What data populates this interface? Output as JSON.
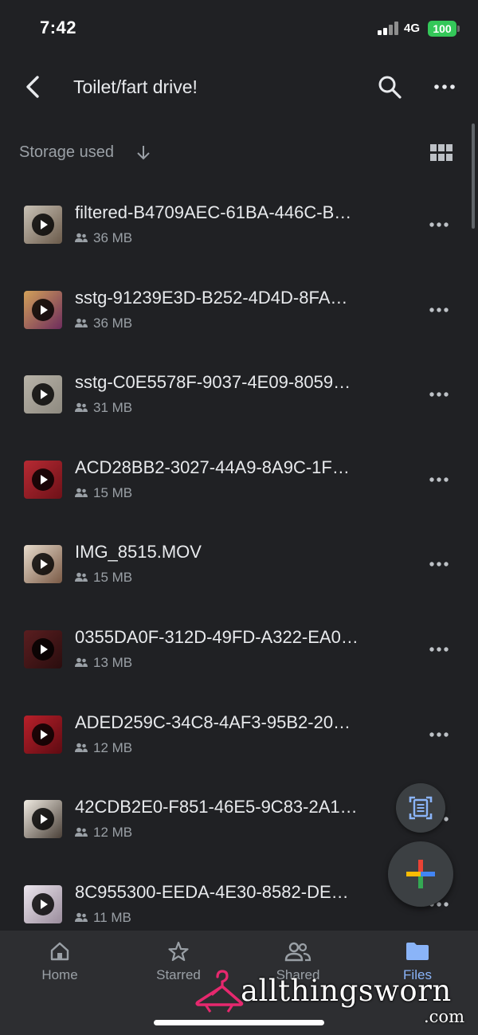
{
  "status_bar": {
    "time": "7:42",
    "network": "4G",
    "battery": "100"
  },
  "header": {
    "title": "Toilet/fart drive!"
  },
  "sort": {
    "label": "Storage used"
  },
  "files": [
    {
      "name": "filtered-B4709AEC-61BA-446C-B…",
      "size": "36 MB",
      "thumb": [
        "#c9c2b6",
        "#6a5a4a"
      ]
    },
    {
      "name": "sstg-91239E3D-B252-4D4D-8FA…",
      "size": "36 MB",
      "thumb": [
        "#d3a15a",
        "#6d2c5c"
      ]
    },
    {
      "name": "sstg-C0E5578F-9037-4E09-8059…",
      "size": "31 MB",
      "thumb": [
        "#b8b3a8",
        "#8e8a80"
      ]
    },
    {
      "name": "ACD28BB2-3027-44A9-8A9C-1F…",
      "size": "15 MB",
      "thumb": [
        "#b72a33",
        "#6e1118"
      ]
    },
    {
      "name": "IMG_8515.MOV",
      "size": "15 MB",
      "thumb": [
        "#e8dccc",
        "#7a5a46"
      ]
    },
    {
      "name": "0355DA0F-312D-49FD-A322-EA0…",
      "size": "13 MB",
      "thumb": [
        "#5a1e20",
        "#2a0d0e"
      ]
    },
    {
      "name": "ADED259C-34C8-4AF3-95B2-20…",
      "size": "12 MB",
      "thumb": [
        "#b9202a",
        "#5e0b12"
      ]
    },
    {
      "name": "42CDB2E0-F851-46E5-9C83-2A1…",
      "size": "12 MB",
      "thumb": [
        "#f0ebe2",
        "#4a4038"
      ]
    },
    {
      "name": "8C955300-EEDA-4E30-8582-DE…",
      "size": "11 MB",
      "thumb": [
        "#ece6ee",
        "#9a8c9c"
      ]
    }
  ],
  "bottom_nav": [
    {
      "label": "Home",
      "icon": "home-icon"
    },
    {
      "label": "Starred",
      "icon": "star-icon"
    },
    {
      "label": "Shared",
      "icon": "shared-icon"
    },
    {
      "label": "Files",
      "icon": "folder-icon",
      "active": true
    }
  ],
  "watermark": {
    "text": "allthingsworn",
    "suffix": ".com"
  },
  "colors": {
    "background": "#202124",
    "accent": "#8ab4f8",
    "battery": "#34c759"
  }
}
